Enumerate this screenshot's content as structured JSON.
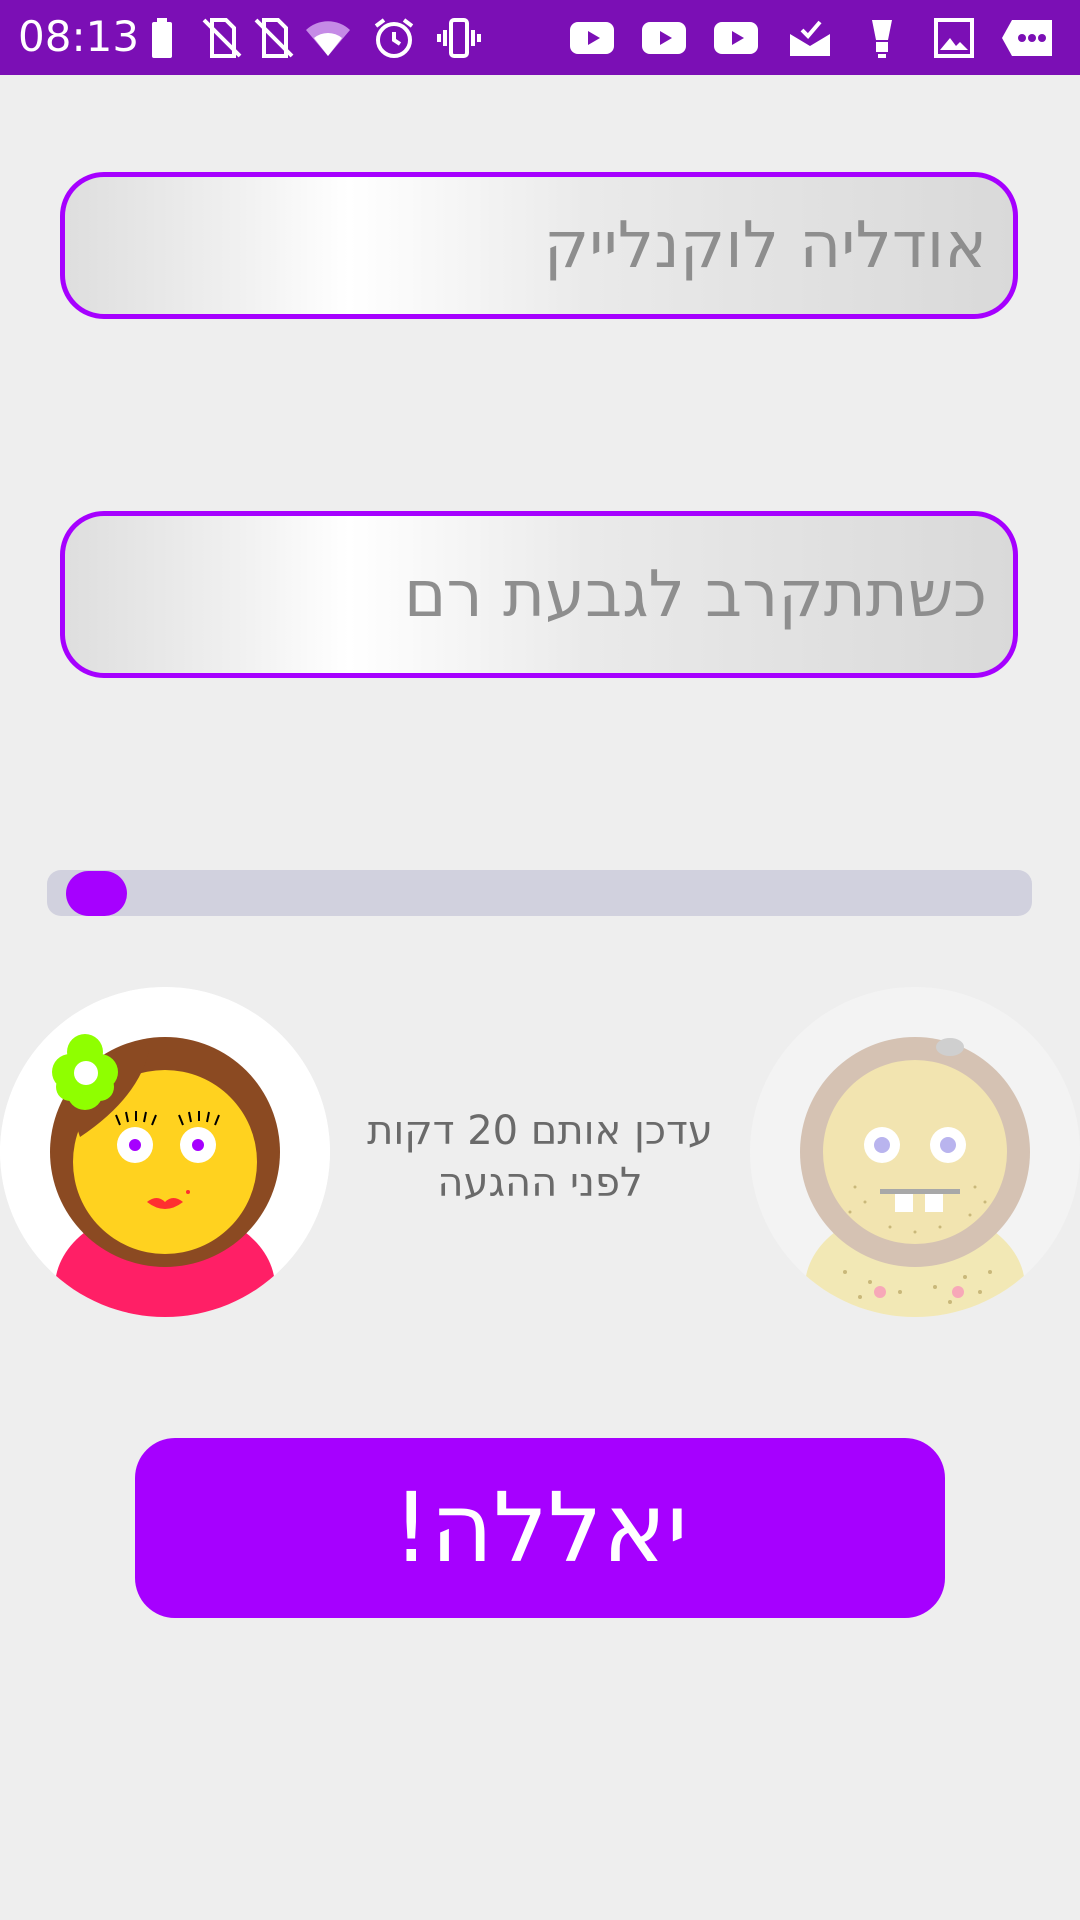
{
  "status_bar": {
    "time": "08:13",
    "icons": [
      "battery-icon",
      "no-sim-icon",
      "no-sim-icon",
      "wifi-icon",
      "alarm-icon",
      "vibrate-icon",
      "youtube-icon",
      "youtube-icon",
      "youtube-icon",
      "mail-done-icon",
      "lightbulb-icon",
      "image-icon",
      "more-icon"
    ],
    "background_color": "#7b0fb5"
  },
  "form": {
    "name_field_value": "אודליה לוקנלייק",
    "message_field_value": "כשתתקרב לגבעת רם"
  },
  "slider": {
    "value_fraction": 0.03,
    "accent_color": "#a600ff"
  },
  "avatars": {
    "left_icon": "girl-avatar-icon",
    "right_icon": "boy-avatar-icon"
  },
  "status_text": {
    "line1": "עדכן אותם 20 דקות",
    "line2": "לפני ההגעה"
  },
  "action_button": {
    "label": "יאללה!"
  }
}
